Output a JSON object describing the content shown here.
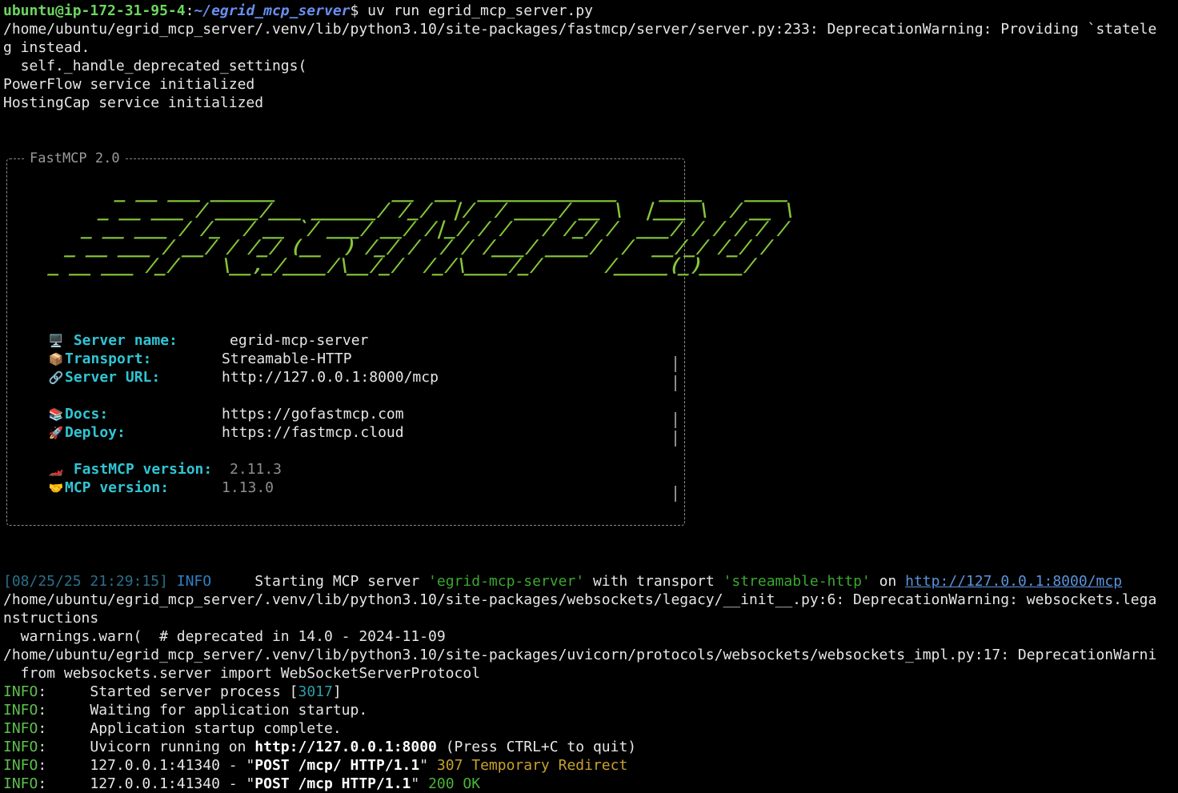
{
  "prompt": {
    "user_host": "ubuntu@ip-172-31-95-4",
    "colon": ":",
    "path": "~/egrid_mcp_server",
    "symbol": "$",
    "command": " uv run egrid_mcp_server.py"
  },
  "pre_lines": [
    "/home/ubuntu/egrid_mcp_server/.venv/lib/python3.10/site-packages/fastmcp/server/server.py:233: DeprecationWarning: Providing `statele",
    "g instead.",
    "  self._handle_deprecated_settings(",
    "PowerFlow service initialized",
    "HostingCap service initialized"
  ],
  "panel": {
    "title": "FastMCP 2.0",
    "logo_ascii": "    _ __ ___ ______           __  __  _____________    ____    ____ \n   _ __ ___ / ____/___ ______/ /_/  |/  / ____/ __ \\  |___ \\  / __ \\\n  _ __ ___ / /_  / __ `/ ___/ __/ /|_/ / /   / /_/ /  ___/ / / / / /\n _ __ ___ / __/ / /_/ (__  ) /_/ /  / / /___/ ____/  /  __/_/ /_/ / \n_ __ ___ /_/    \\__,_/____/\\__/_/  /_/\\____/_/      /_____(_)____/  ",
    "rows": [
      {
        "icon": "computer-icon",
        "glyph": "🖥️",
        "key": "Server name:",
        "value": "egrid-mcp-server",
        "dim": false
      },
      {
        "icon": "package-icon",
        "glyph": "📦",
        "key": "Transport:",
        "value": "Streamable-HTTP",
        "dim": false
      },
      {
        "icon": "link-icon",
        "glyph": "🔗",
        "key": "Server URL:",
        "value": "http://127.0.0.1:8000/mcp",
        "dim": false
      },
      {
        "icon": "books-icon",
        "glyph": "📚",
        "key": "Docs:",
        "value": "https://gofastmcp.com",
        "dim": false
      },
      {
        "icon": "rocket-icon",
        "glyph": "🚀",
        "key": "Deploy:",
        "value": "https://fastmcp.cloud",
        "dim": false
      },
      {
        "icon": "race-car-icon",
        "glyph": "🏎️",
        "key": "FastMCP version:",
        "value": "2.11.3",
        "dim": true
      },
      {
        "icon": "handshake-icon",
        "glyph": "🤝",
        "key": "MCP version:",
        "value": "1.13.0",
        "dim": true
      }
    ]
  },
  "start_line": {
    "timestamp": "[08/25/25 21:29:15]",
    "level": "INFO",
    "text1": "     Starting MCP server ",
    "server": "'egrid-mcp-server'",
    "text2": " with transport ",
    "transport": "'streamable-http'",
    "text3": " on ",
    "url": "http://127.0.0.1:8000/mcp"
  },
  "post_lines": [
    "/home/ubuntu/egrid_mcp_server/.venv/lib/python3.10/site-packages/websockets/legacy/__init__.py:6: DeprecationWarning: websockets.lega",
    "nstructions",
    "  warnings.warn(  # deprecated in 14.0 - 2024-11-09",
    "/home/ubuntu/egrid_mcp_server/.venv/lib/python3.10/site-packages/uvicorn/protocols/websockets/websockets_impl.py:17: DeprecationWarni",
    "  from websockets.server import WebSocketServerProtocol"
  ],
  "info_lines": {
    "label": "INFO",
    "colon": ":",
    "l1_text": "     Started server process [",
    "l1_pid": "3017",
    "l1_end": "]",
    "l2_text": "     Waiting for application startup.",
    "l3_text": "     Application startup complete.",
    "l4_pre": "     Uvicorn running on ",
    "l4_url": "http://127.0.0.1:8000",
    "l4_post": " (Press CTRL+C to quit)",
    "l5_pre": "     127.0.0.1:41340 - \"",
    "l5_req": "POST /mcp/ HTTP/1.1",
    "l5_mid": "\" ",
    "l5_status": "307 Temporary Redirect",
    "l6_pre": "     127.0.0.1:41340 - \"",
    "l6_req": "POST /mcp HTTP/1.1",
    "l6_mid": "\" ",
    "l6_status": "200 OK"
  },
  "colors": {
    "background": "#000000",
    "prompt_user": "#6cd65f",
    "prompt_path": "#6a8ff0",
    "logo": "#86c63a",
    "panel_key": "#30c5d4",
    "info_label": "#5ec04e",
    "redirect_status": "#c8a22c"
  }
}
